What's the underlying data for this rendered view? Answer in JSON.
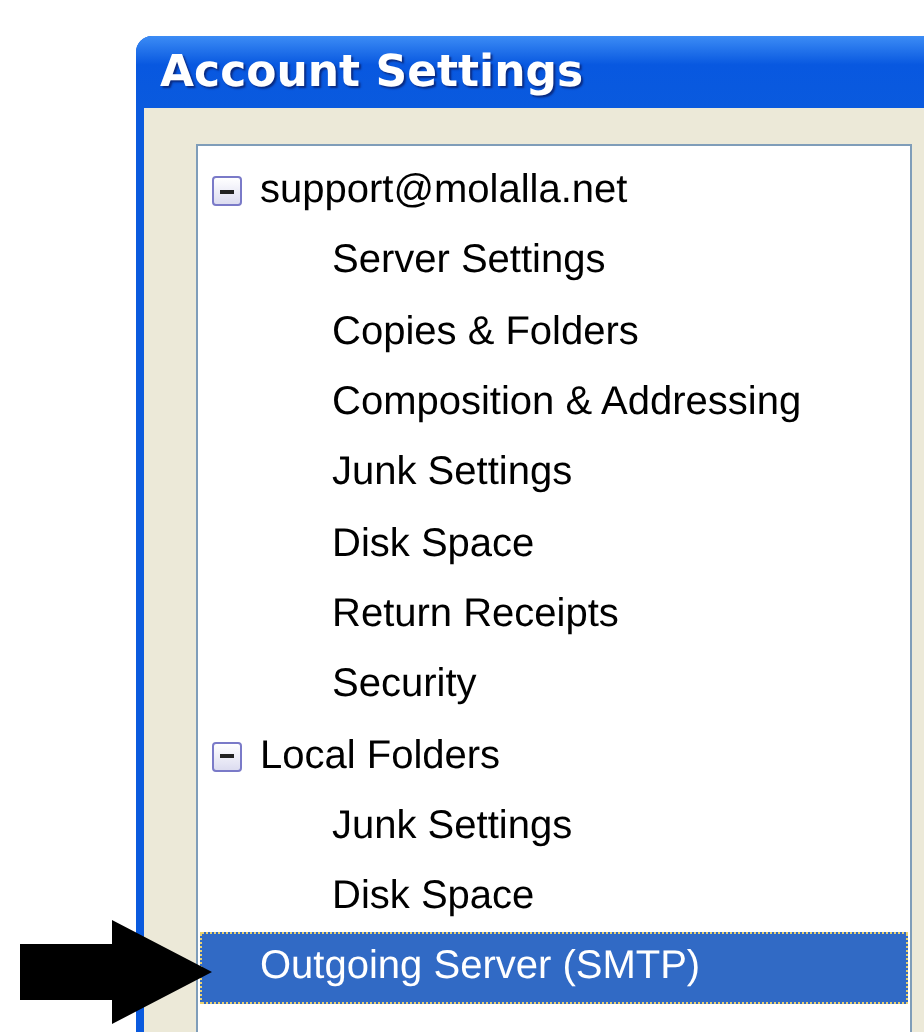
{
  "window": {
    "title": "Account Settings"
  },
  "tree": {
    "items": [
      {
        "label": "support@molalla.net",
        "expanded": true,
        "selected": false,
        "children": [
          {
            "label": "Server Settings",
            "selected": false
          },
          {
            "label": "Copies & Folders",
            "selected": false
          },
          {
            "label": "Composition & Addressing",
            "selected": false
          },
          {
            "label": "Junk Settings",
            "selected": false
          },
          {
            "label": "Disk Space",
            "selected": false
          },
          {
            "label": "Return Receipts",
            "selected": false
          },
          {
            "label": "Security",
            "selected": false
          }
        ]
      },
      {
        "label": "Local Folders",
        "expanded": true,
        "selected": false,
        "children": [
          {
            "label": "Junk Settings",
            "selected": false
          },
          {
            "label": "Disk Space",
            "selected": false
          }
        ]
      },
      {
        "label": "Outgoing Server (SMTP)",
        "selected": true
      }
    ]
  }
}
